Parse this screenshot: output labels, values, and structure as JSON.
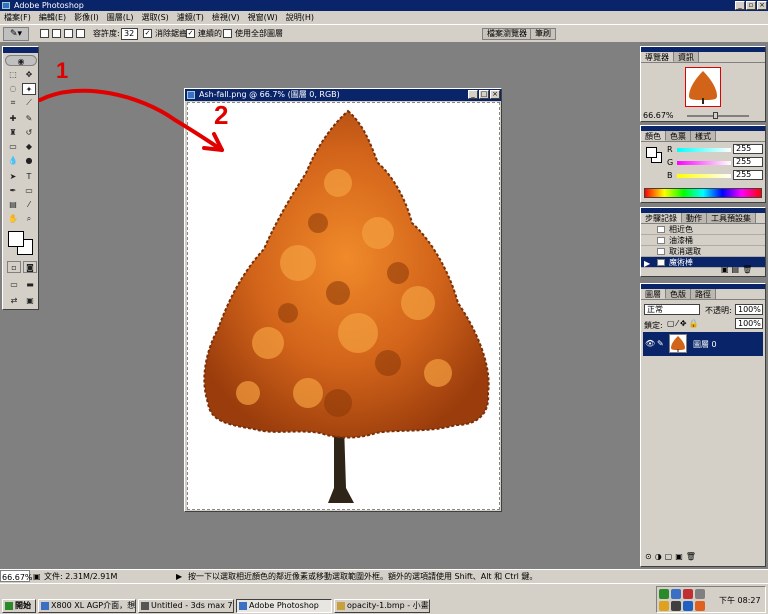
{
  "window": {
    "title": "Adobe Photoshop"
  },
  "menu": [
    "檔案(F)",
    "編輯(E)",
    "影像(I)",
    "圖層(L)",
    "選取(S)",
    "濾鏡(T)",
    "檢視(V)",
    "視窗(W)",
    "說明(H)"
  ],
  "options": {
    "tolerance_label": "容許度:",
    "tolerance_value": "32",
    "antialias_label": "消除鋸齒",
    "contiguous_label": "連續的",
    "use_all_layers_label": "使用全部圖層",
    "palette_well": [
      "檔案瀏覽器",
      "筆刷"
    ]
  },
  "document": {
    "title": "Ash-fall.png @ 66.7% (圖層 0, RGB)"
  },
  "annotations": {
    "n1": "1",
    "n2": "2"
  },
  "navigator": {
    "tabs": [
      "導覽器",
      "資訊"
    ],
    "zoom": "66.67%"
  },
  "color": {
    "tabs": [
      "顏色",
      "色票",
      "樣式"
    ],
    "r_label": "R",
    "g_label": "G",
    "b_label": "B",
    "r": "255",
    "g": "255",
    "b": "255"
  },
  "history": {
    "tabs": [
      "步驟記錄",
      "動作",
      "工具預設集"
    ],
    "items": [
      "相近色",
      "油漆桶",
      "取消選取",
      "魔術棒"
    ]
  },
  "layers": {
    "tabs": [
      "圖層",
      "色版",
      "路徑"
    ],
    "blend_mode": "正常",
    "opacity_label": "不透明:",
    "opacity": "100%",
    "lock_label": "鎖定:",
    "fill": "100%",
    "layer_name": "圖層 0"
  },
  "status": {
    "zoom": "66.67%",
    "doc_size": "文件: 2.31M/2.91M",
    "hint": "按一下以選取相近顏色的鄰近像素或移動選取範圍外框。額外的選項請使用 Shift、Alt 和 Ctrl 鍵。"
  },
  "taskbar": {
    "start": "開始",
    "tasks": [
      "X800 XL AGP介面，想...",
      "Untitled - 3ds max 7 - Sta...",
      "Adobe Photoshop",
      "opacity-1.bmp - 小畫家"
    ],
    "clock": "下午 08:27"
  },
  "colors": {
    "title_blue": "#0a246a",
    "chrome": "#d4d0c8",
    "workspace": "#808080",
    "annotation_red": "#e00000",
    "tree_orange": "#d2641a"
  }
}
